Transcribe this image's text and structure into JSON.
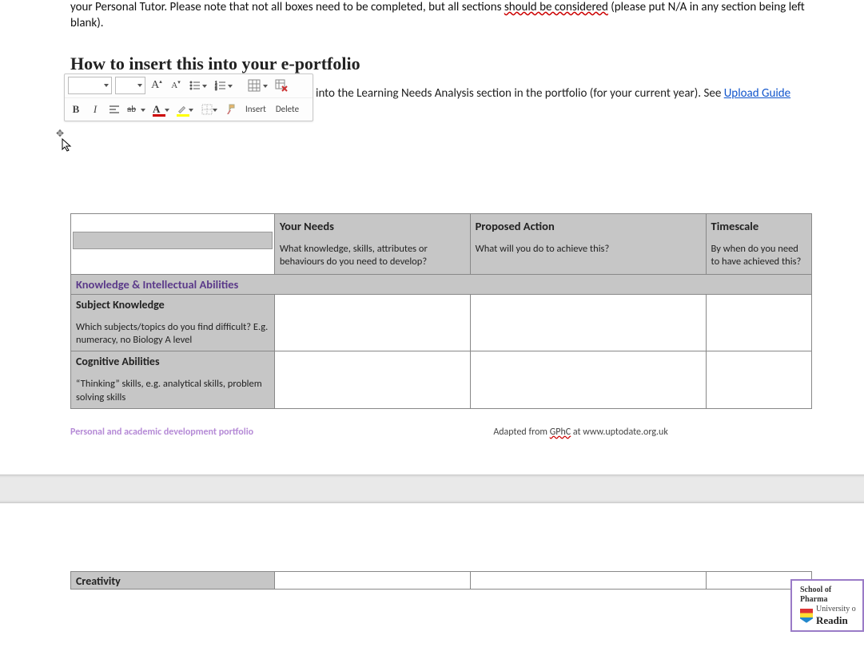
{
  "intro": {
    "pre": "your Personal Tutor. Please note that not all boxes need to be completed, but all sections ",
    "wavy": "should be considered",
    "post": " (please put N/A in any section being left blank)."
  },
  "heading": "How to insert this into your e-portfolio",
  "para2": {
    "text": "into the Learning Needs Analysis section in the portfolio (for your current year). See ",
    "link": "Upload Guide"
  },
  "toolbar": {
    "insert": "Insert",
    "delete": "Delete"
  },
  "table": {
    "headers": {
      "needs_title": "Your Needs",
      "needs_sub": "What knowledge, skills, attributes or behaviours do you need to develop?",
      "action_title": "Proposed Action",
      "action_sub": "What will you do to achieve this?",
      "time_title": "Timescale",
      "time_sub": "By when do you need to have achieved this?"
    },
    "section1": "Knowledge & Intellectual Abilities",
    "rows": [
      {
        "title": "Subject Knowledge",
        "sub": "Which subjects/topics do you find difficult? E.g. numeracy, no Biology A level"
      },
      {
        "title": "Cognitive Abilities",
        "sub": "“Thinking” skills, e.g. analytical skills, problem solving skills"
      }
    ]
  },
  "footer": {
    "left": "Personal and academic development portfolio",
    "right_pre": "Adapted from ",
    "right_wavy": "GPhC",
    "right_post": " at www.uptodate.org.uk"
  },
  "badge": {
    "line1": "School of Pharma",
    "line2": "University o",
    "line3": "Readin"
  },
  "page2_row": "Creativity"
}
